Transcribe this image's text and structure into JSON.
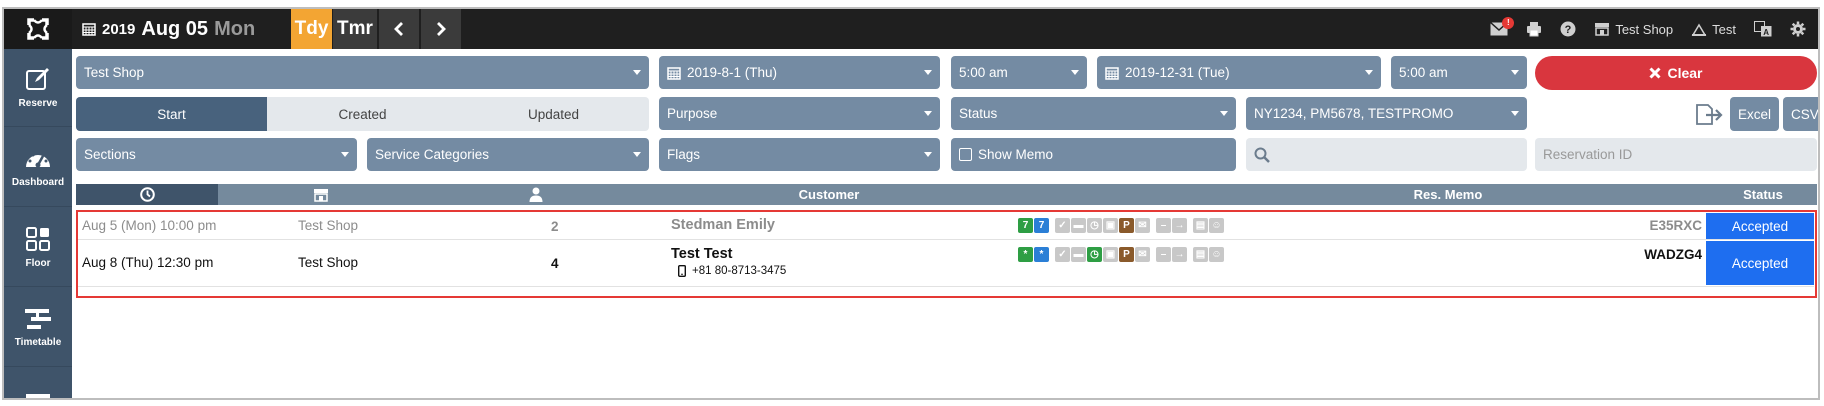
{
  "topbar": {
    "year": "2019",
    "month_day": "Aug 05",
    "weekday": "Mon",
    "today_label": "Tdy",
    "tomorrow_label": "Tmr",
    "prev_label": "❮",
    "next_label": "❯",
    "mail_badge": "!",
    "shop_label": "Test Shop",
    "user_label": "Test"
  },
  "sidebar": {
    "items": [
      {
        "label": "Reserve",
        "icon": "edit-icon"
      },
      {
        "label": "Dashboard",
        "icon": "dashboard-icon"
      },
      {
        "label": "Floor",
        "icon": "grid-icon"
      },
      {
        "label": "Timetable",
        "icon": "timetable-icon"
      }
    ]
  },
  "filters": {
    "shop": "Test Shop",
    "start_date": "2019-8-1 (Thu)",
    "start_time": "5:00 am",
    "end_date": "2019-12-31 (Tue)",
    "end_time": "5:00 am",
    "clear_label": "Clear",
    "seg_start": "Start",
    "seg_created": "Created",
    "seg_updated": "Updated",
    "purpose": "Purpose",
    "status": "Status",
    "promo": "NY1234, PM5678, TESTPROMO",
    "sections": "Sections",
    "service_categories": "Service Categories",
    "flags": "Flags",
    "show_memo": "Show Memo",
    "search_value": "",
    "reservation_id_placeholder": "Reservation ID",
    "excel_label": "Excel",
    "csv_label": "CSV"
  },
  "table": {
    "headers": {
      "customer": "Customer",
      "res_memo": "Res. Memo",
      "status": "Status"
    },
    "rows": [
      {
        "datetime": "Aug 5 (Mon) 10:00 pm",
        "shop": "Test Shop",
        "guests": "2",
        "name": "Stedman Emily",
        "phone": "",
        "tag1": "7",
        "tag2": "7",
        "code": "E35RXC",
        "status": "Accepted"
      },
      {
        "datetime": "Aug 8 (Thu) 12:30 pm",
        "shop": "Test Shop",
        "guests": "4",
        "name": "Test Test",
        "phone": "+81 80-8713-3475",
        "tag1": "*",
        "tag2": "*",
        "code": "WADZG4",
        "status": "Accepted"
      }
    ]
  },
  "colors": {
    "accent_orange": "#f3a533",
    "clear_red": "#d9363e",
    "status_blue": "#1e6ef0",
    "highlight_red": "#e53935",
    "green_tag": "#2e9e44",
    "blue_tag": "#2b7fd6",
    "parking_brown": "#8a5a2b"
  }
}
